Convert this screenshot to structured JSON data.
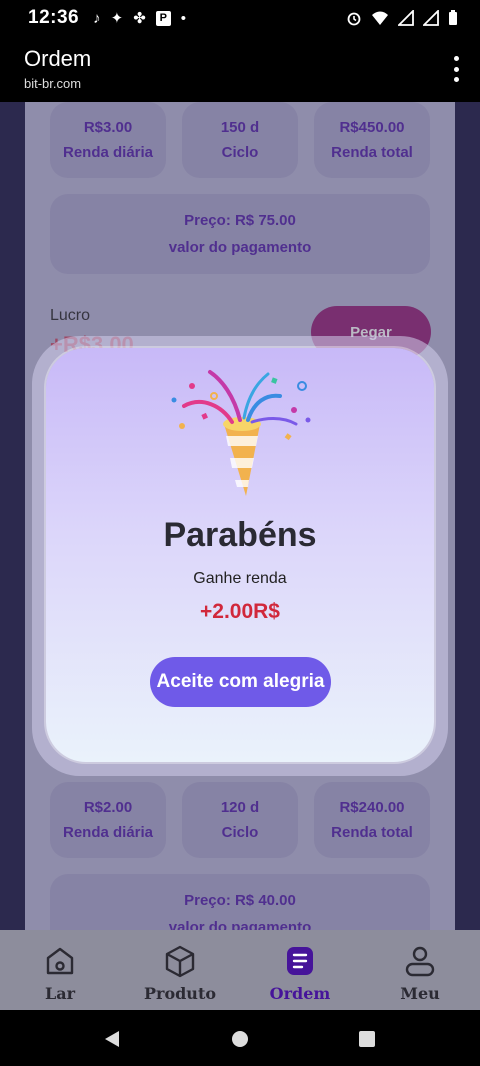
{
  "status_bar": {
    "time": "12:36"
  },
  "app_bar": {
    "title": "Ordem",
    "subtitle": "bit-br.com"
  },
  "card_top": {
    "stats": [
      {
        "value": "R$3.00",
        "label": "Renda diária"
      },
      {
        "value": "150 d",
        "label": "Ciclo"
      },
      {
        "value": "R$450.00",
        "label": "Renda total"
      }
    ],
    "price": {
      "value": "Preço: R$ 75.00",
      "label": "valor do pagamento"
    },
    "profit_label": "Lucro",
    "profit_value": "+R$3.00",
    "button": "Pegar"
  },
  "card_bottom": {
    "stats": [
      {
        "value": "R$2.00",
        "label": "Renda diária"
      },
      {
        "value": "120 d",
        "label": "Ciclo"
      },
      {
        "value": "R$240.00",
        "label": "Renda total"
      }
    ],
    "price": {
      "value": "Preço: R$ 40.00",
      "label": "valor do pagamento"
    }
  },
  "modal": {
    "icon": "party-popper-icon",
    "heading": "Parabéns",
    "subtext": "Ganhe renda",
    "amount": "+2.00R$",
    "accept_button": "Aceite com alegria"
  },
  "bottom_nav": {
    "items": [
      {
        "label": "Lar",
        "icon": "home-icon"
      },
      {
        "label": "Produto",
        "icon": "cube-icon"
      },
      {
        "label": "Ordem",
        "icon": "list-icon",
        "active": true
      },
      {
        "label": "Meu",
        "icon": "user-icon"
      }
    ]
  },
  "colors": {
    "accent": "#6f5ae8",
    "amount": "#d1283b",
    "active_nav": "#46149a"
  }
}
